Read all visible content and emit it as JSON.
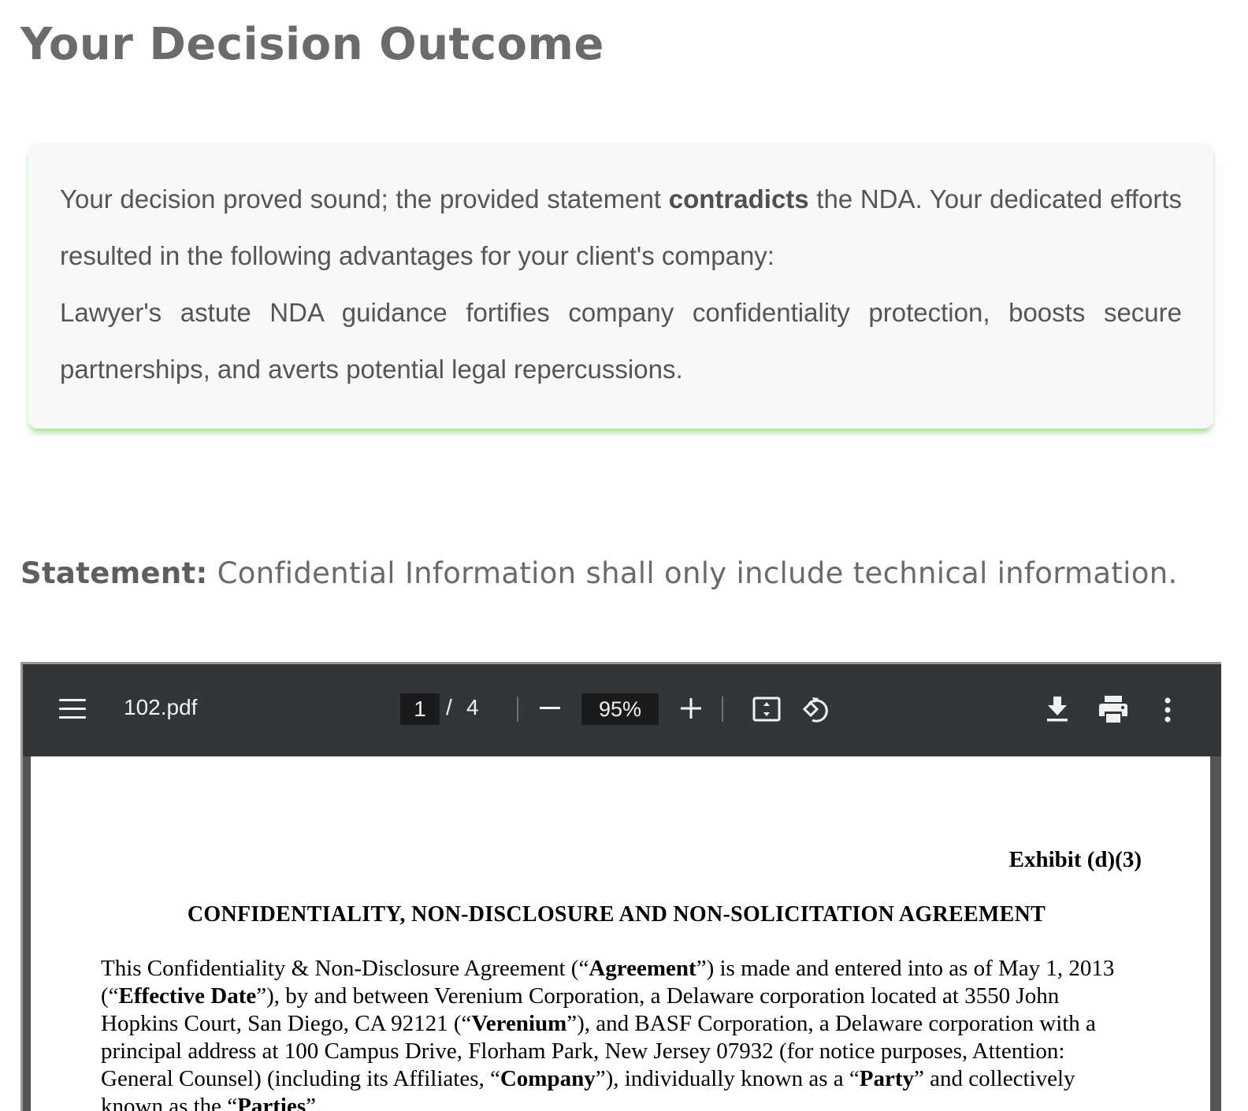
{
  "header": {
    "title": "Your Decision Outcome"
  },
  "outcome": {
    "para1_before": "Your decision proved sound; the provided statement ",
    "para1_bold": "contradicts",
    "para1_after": " the NDA. Your dedicated efforts resulted in the following advantages for your client's company:",
    "para2": "Lawyer's astute NDA guidance fortifies company confidentiality protection, boosts secure partnerships, and averts potential legal repercussions.",
    "accent_color": "#a6e49a"
  },
  "statement": {
    "label": "Statement:",
    "text": " Confidential Information shall only include technical information."
  },
  "viewer": {
    "filename": "102.pdf",
    "current_page": "1",
    "page_separator": "/",
    "total_pages": "4",
    "zoom": "95%",
    "icons": [
      "menu-icon",
      "zoom-out-icon",
      "zoom-in-icon",
      "fit-page-icon",
      "rotate-icon",
      "download-icon",
      "print-icon",
      "more-icon"
    ]
  },
  "document": {
    "exhibit": "Exhibit (d)(3)",
    "title": "CONFIDENTIALITY, NON-DISCLOSURE AND NON-SOLICITATION AGREEMENT",
    "body": [
      "This Confidentiality & Non-Disclosure Agreement (“",
      "Agreement",
      "”) is made and entered into as of May 1, 2013 (“",
      "Effective Date",
      "”), by and between Verenium Corporation, a Delaware corporation located at 3550 John Hopkins Court, San Diego, CA 92121 (“",
      "Verenium",
      "”), and BASF Corporation, a Delaware corporation with a principal address at 100 Campus Drive, Florham Park, New Jersey 07932 (for notice purposes, Attention: General Counsel)  (including its Affiliates, “",
      "Company",
      "”), individually known as a “",
      "Party",
      "” and collectively known as the “",
      "Parties",
      "”."
    ]
  }
}
